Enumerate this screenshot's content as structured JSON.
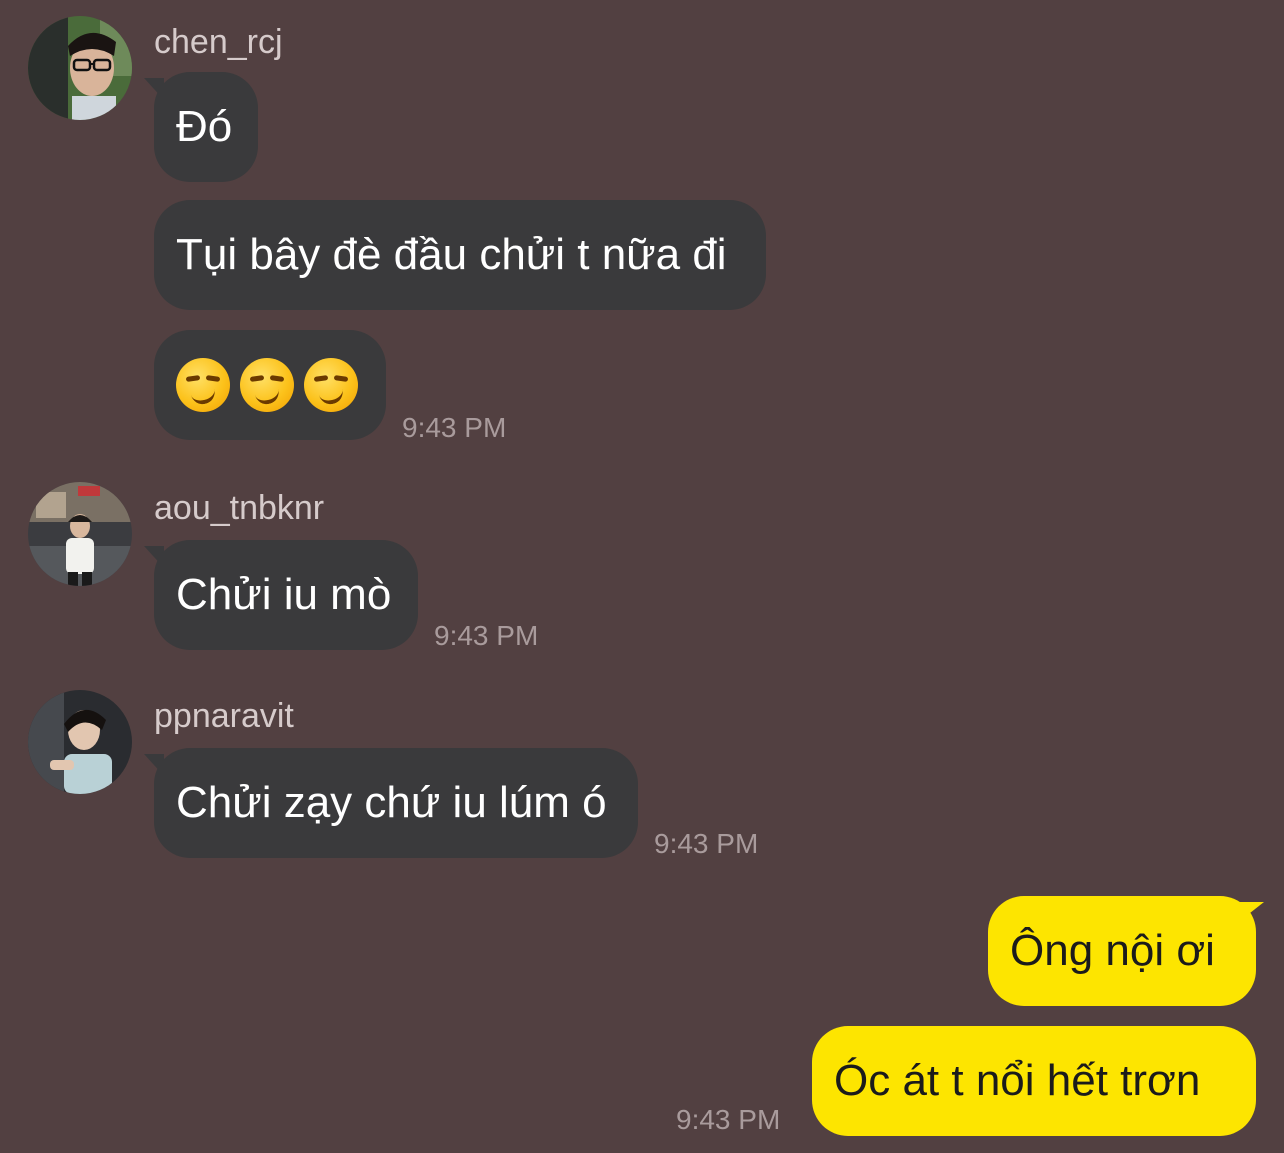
{
  "messages": [
    {
      "sender": "chen_rcj",
      "avatar": "profile-photo-chen",
      "bubbles": [
        "Đó",
        "Tụi bây đè đầu chửi t nữa đi"
      ],
      "emoji": [
        "smirking-face",
        "smirking-face",
        "smirking-face"
      ],
      "time": "9:43 PM"
    },
    {
      "sender": "aou_tnbknr",
      "avatar": "profile-photo-aou",
      "bubbles": [
        "Chửi iu mò"
      ],
      "time": "9:43 PM"
    },
    {
      "sender": "ppnaravit",
      "avatar": "profile-photo-pp",
      "bubbles": [
        "Chửi zạy chứ iu lúm ó"
      ],
      "time": "9:43 PM"
    }
  ],
  "my_messages": {
    "bubbles": [
      "Ông nội ơi",
      "Óc át t nổi hết trơn"
    ],
    "time": "9:43 PM"
  },
  "colors": {
    "background": "#524041",
    "incoming_bubble": "#3a3a3c",
    "outgoing_bubble": "#fde500",
    "timestamp": "#a99b9c"
  }
}
